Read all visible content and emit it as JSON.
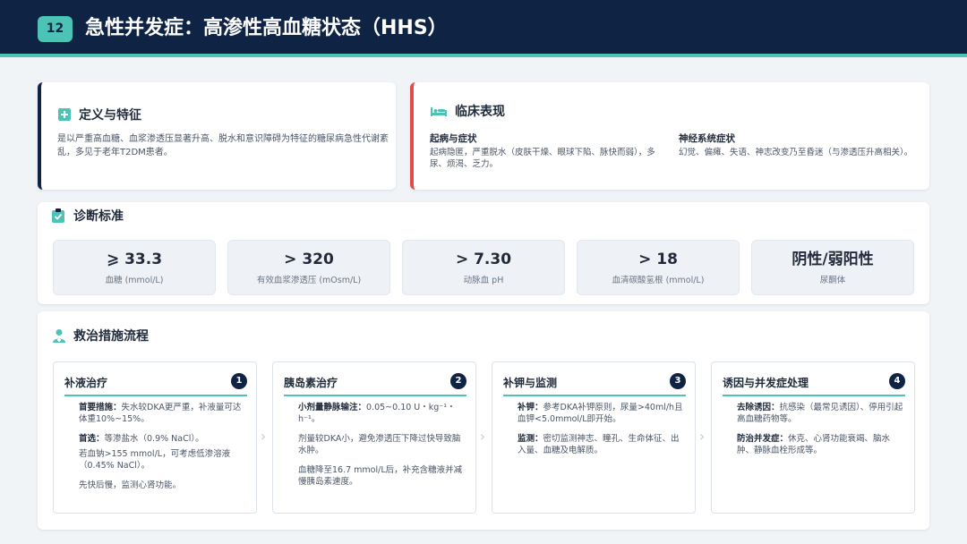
{
  "header": {
    "page_number": "12",
    "title": "急性并发症：高渗性高血糖状态（HHS）"
  },
  "definition": {
    "title": "定义与特征",
    "text": "是以严重高血糖、血浆渗透压显著升高、脱水和意识障碍为特征的糖尿病急性代谢紊乱，多见于老年T2DM患者。"
  },
  "clinical": {
    "title": "临床表现",
    "columns": [
      {
        "title": "起病与症状",
        "text": "起病隐匿，严重脱水（皮肤干燥、眼球下陷、脉快而弱），多尿、烦渴、乏力。"
      },
      {
        "title": "神经系统症状",
        "text": "幻觉、偏瘫、失语、神志改变乃至昏迷（与渗透压升高相关）。"
      }
    ]
  },
  "diagnosis": {
    "title": "诊断标准",
    "metrics": [
      {
        "value": "⩾ 33.3",
        "label": "血糖 (mmol/L)"
      },
      {
        "value": "> 320",
        "label": "有效血浆渗透压 (mOsm/L)"
      },
      {
        "value": "> 7.30",
        "label": "动脉血 pH"
      },
      {
        "value": "> 18",
        "label": "血清碳酸氢根 (mmol/L)"
      },
      {
        "value": "阴性/弱阳性",
        "label": "尿酮体"
      }
    ]
  },
  "treatment": {
    "title": "救治措施流程",
    "steps": [
      {
        "title": "补液治疗",
        "num": "1",
        "items": [
          {
            "bold": "首要措施：",
            "text": "失水较DKA更严重，补液量可达体重10%~15%。"
          },
          {
            "bold": "首选：",
            "text": "等渗盐水（0.9% NaCl）。"
          },
          {
            "bold": "",
            "text": "若血钠>155 mmol/L，可考虑低渗溶液（0.45% NaCl）。"
          },
          {
            "bold": "",
            "text": "先快后慢，监测心肾功能。"
          }
        ]
      },
      {
        "title": "胰岛素治疗",
        "num": "2",
        "items": [
          {
            "bold": "小剂量静脉输注：",
            "text": "0.05~0.10 U・kg⁻¹・h⁻¹。"
          },
          {
            "bold": "",
            "text": "剂量较DKA小，避免渗透压下降过快导致脑水肿。"
          },
          {
            "bold": "",
            "text": "血糖降至16.7 mmol/L后，补充含糖液并减慢胰岛素速度。"
          }
        ]
      },
      {
        "title": "补钾与监测",
        "num": "3",
        "items": [
          {
            "bold": "补钾：",
            "text": "参考DKA补钾原则，尿量>40ml/h且血钾<5.0mmol/L即开始。"
          },
          {
            "bold": "监测：",
            "text": "密切监测神志、瞳孔、生命体征、出入量、血糖及电解质。"
          }
        ]
      },
      {
        "title": "诱因与并发症处理",
        "num": "4",
        "items": [
          {
            "bold": "去除诱因：",
            "text": "抗感染（最常见诱因）、停用引起高血糖药物等。"
          },
          {
            "bold": "防治并发症：",
            "text": "休克、心肾功能衰竭、脑水肿、静脉血栓形成等。"
          }
        ]
      }
    ]
  },
  "colors": {
    "navy": "#0f2345",
    "teal": "#4cc3b5",
    "red": "#e04b4b"
  }
}
